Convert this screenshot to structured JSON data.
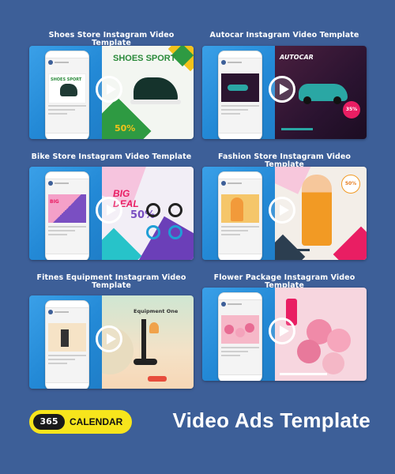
{
  "cards": [
    {
      "title": "Shoes Store Instagram Video Template",
      "headline": "SHOES SPORT",
      "discount": "50%"
    },
    {
      "title": "Autocar Instagram Video Template",
      "headline": "AUTOCAR",
      "discount": "35%"
    },
    {
      "title": "Bike Store Instagram Video Template",
      "headline": "BIG DEAL",
      "discount": "50%"
    },
    {
      "title": "Fashion Store Instagram Video Template",
      "headline": "",
      "discount": "50%"
    },
    {
      "title": "Fitnes Equipment Instagram Video Template",
      "headline": "Equipment One",
      "discount": ""
    },
    {
      "title": "Flower Package Instagram Video Template",
      "headline": "",
      "discount": ""
    }
  ],
  "badge": {
    "number": "365",
    "label": "CALENDAR"
  },
  "main_title": "Video Ads Template",
  "colors": {
    "background": "#3d5f98",
    "badge": "#f7e51c",
    "phone_panel": "#2389d6"
  }
}
